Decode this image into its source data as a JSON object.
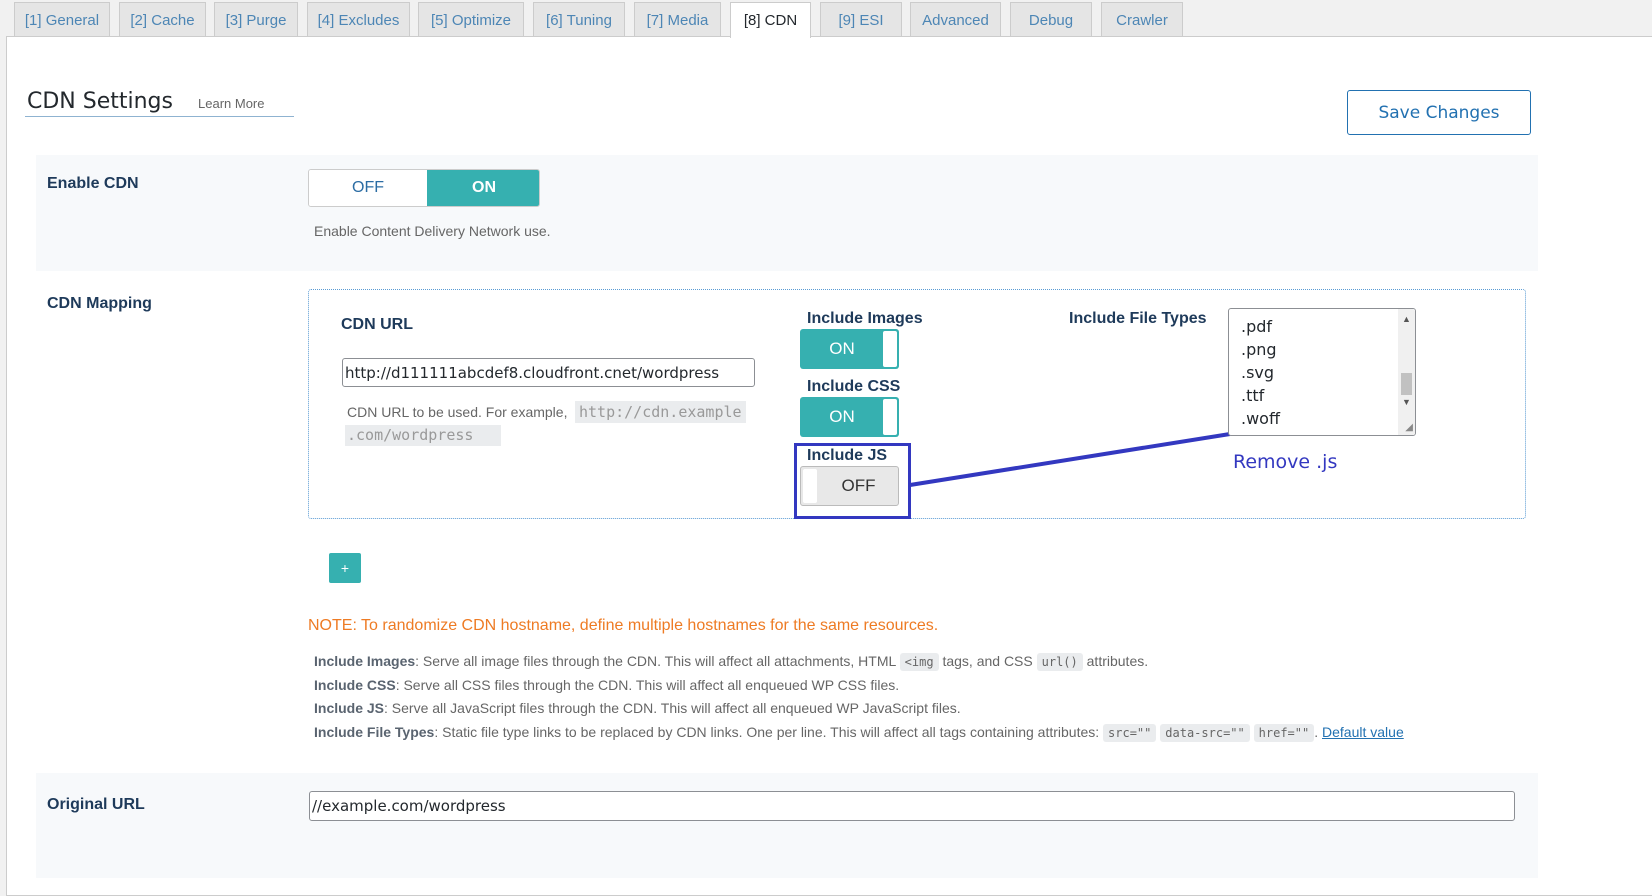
{
  "tabs": [
    {
      "label": "[1] General"
    },
    {
      "label": "[2] Cache"
    },
    {
      "label": "[3] Purge"
    },
    {
      "label": "[4] Excludes"
    },
    {
      "label": "[5] Optimize"
    },
    {
      "label": "[6] Tuning"
    },
    {
      "label": "[7] Media"
    },
    {
      "label": "[8] CDN"
    },
    {
      "label": "[9] ESI"
    },
    {
      "label": "Advanced"
    },
    {
      "label": "Debug"
    },
    {
      "label": "Crawler"
    }
  ],
  "active_tab": "[8] CDN",
  "header": {
    "title": "CDN Settings",
    "learn_more": "Learn More",
    "save_label": "Save Changes"
  },
  "enable_cdn": {
    "label": "Enable CDN",
    "off_label": "OFF",
    "on_label": "ON",
    "state": "ON",
    "description": "Enable Content Delivery Network use."
  },
  "mapping": {
    "label": "CDN Mapping",
    "cdn_url_label": "CDN URL",
    "cdn_url_value": "http://d111111abcdef8.cloudfront.cnet/wordpress",
    "cdn_url_help_prefix": "CDN URL to be used. For example,",
    "cdn_url_example_line1": "http://cdn.example",
    "cdn_url_example_line2": ".com/wordpress",
    "include_images": {
      "label": "Include Images",
      "state": "ON"
    },
    "include_css": {
      "label": "Include CSS",
      "state": "ON"
    },
    "include_js": {
      "label": "Include JS",
      "state": "OFF"
    },
    "file_types_label": "Include File Types",
    "file_types": [
      ".pdf",
      ".png",
      ".svg",
      ".ttf",
      ".woff"
    ],
    "annotation": "Remove .js",
    "add_label": "+"
  },
  "note": "NOTE: To randomize CDN hostname, define multiple hostnames for the same resources.",
  "help": {
    "images_label": "Include Images",
    "images_text1": ": Serve all image files through the CDN. This will affect all attachments, HTML",
    "images_code1": "<img",
    "images_text2": "tags, and CSS",
    "images_code2": "url()",
    "images_text3": "attributes.",
    "css_label": "Include CSS",
    "css_text": ": Serve all CSS files through the CDN. This will affect all enqueued WP CSS files.",
    "js_label": "Include JS",
    "js_text": ": Serve all JavaScript files through the CDN. This will affect all enqueued WP JavaScript files.",
    "ft_label": "Include File Types",
    "ft_text": ": Static file type links to be replaced by CDN links. One per line. This will affect all tags containing attributes:",
    "ft_code1": "src=\"\"",
    "ft_code2": "data-src=\"\"",
    "ft_code3": "href=\"\"",
    "ft_link": "Default value"
  },
  "original_url": {
    "label": "Original URL",
    "value": "//example.com/wordpress"
  },
  "colors": {
    "accent": "#36b0b0",
    "link": "#2271b1",
    "note": "#ee7b24",
    "annotation": "#3338c0"
  }
}
